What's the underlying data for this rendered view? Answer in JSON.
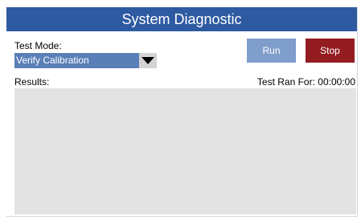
{
  "window": {
    "title": "System Diagnostic"
  },
  "test_mode": {
    "label": "Test Mode:",
    "selected": "Verify Calibration"
  },
  "buttons": {
    "run": "Run",
    "stop": "Stop"
  },
  "results": {
    "label": "Results:",
    "timer_label": "Test Ran For:",
    "timer_value": "00:00:00"
  },
  "colors": {
    "title_bar": "#2e5aa1",
    "select_bg": "#5a7fb7",
    "run_button": "#7f9ecb",
    "stop_button": "#941c20",
    "results_bg": "#e3e3e3"
  },
  "icons": {
    "dropdown": "triangle-down-icon"
  }
}
